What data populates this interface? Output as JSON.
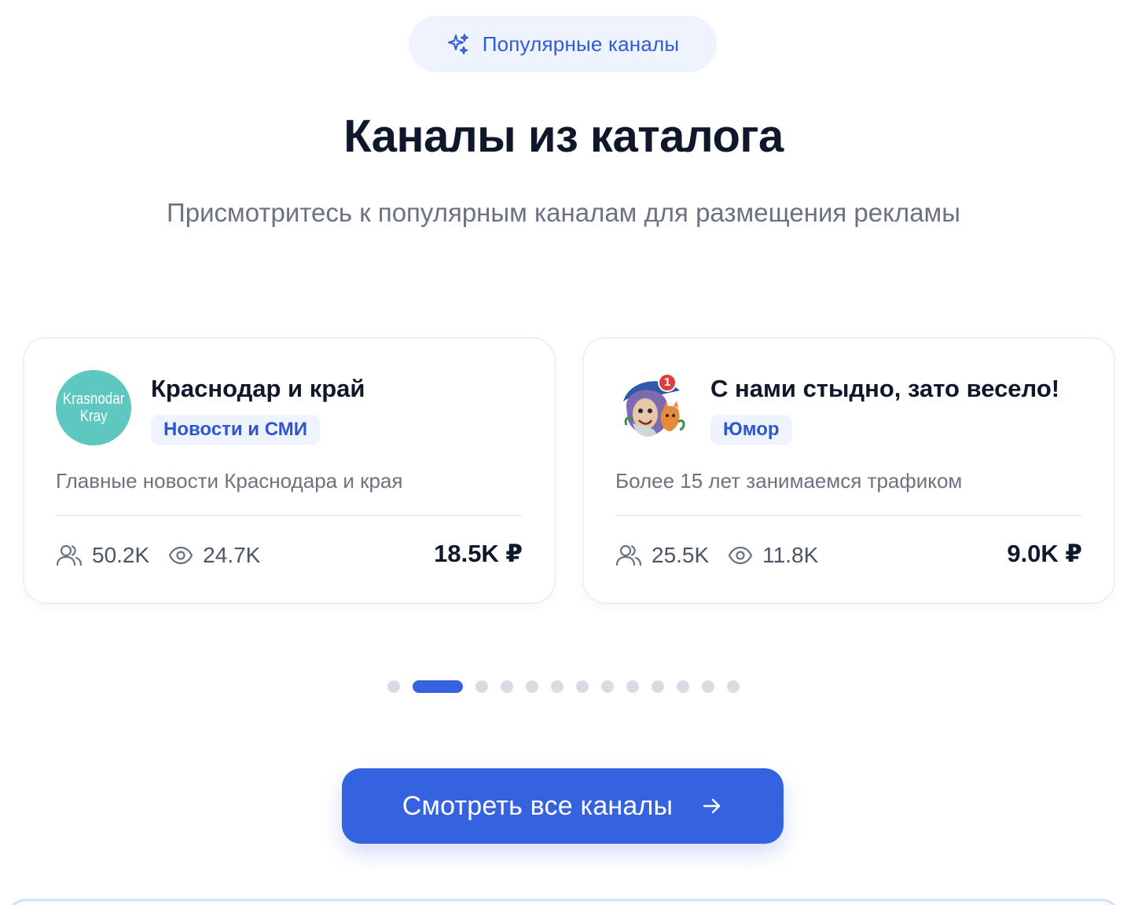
{
  "badge": {
    "label": "Популярные каналы",
    "icon": "sparkles-icon"
  },
  "header": {
    "title": "Каналы из каталога",
    "subtitle": "Присмотритесь к популярным каналам для размещения рекламы"
  },
  "cards": [
    {
      "avatar_text": "Krasnodar\nKray",
      "name": "Краснодар и край",
      "category": "Новости и СМИ",
      "description": "Главные новости Краснодара и края",
      "subscribers": "50.2K",
      "views": "24.7K",
      "price": "18.5K ₽"
    },
    {
      "avatar_text": "",
      "avatar_badge": "1",
      "name": "С нами стыдно, зато весело!",
      "category": "Юмор",
      "description": "Более 15 лет занимаемся трафиком",
      "subscribers": "25.5K",
      "views": "11.8K",
      "price": "9.0K ₽"
    }
  ],
  "pagination": {
    "total": 13,
    "active_index": 1
  },
  "cta": {
    "label": "Смотреть все каналы",
    "icon": "arrow-right-icon"
  },
  "colors": {
    "accent": "#3563e0",
    "tag_bg": "#eef3fd",
    "tag_text": "#2f56cc",
    "muted_text": "#6b7280",
    "avatar_teal": "#5ec7c0"
  }
}
